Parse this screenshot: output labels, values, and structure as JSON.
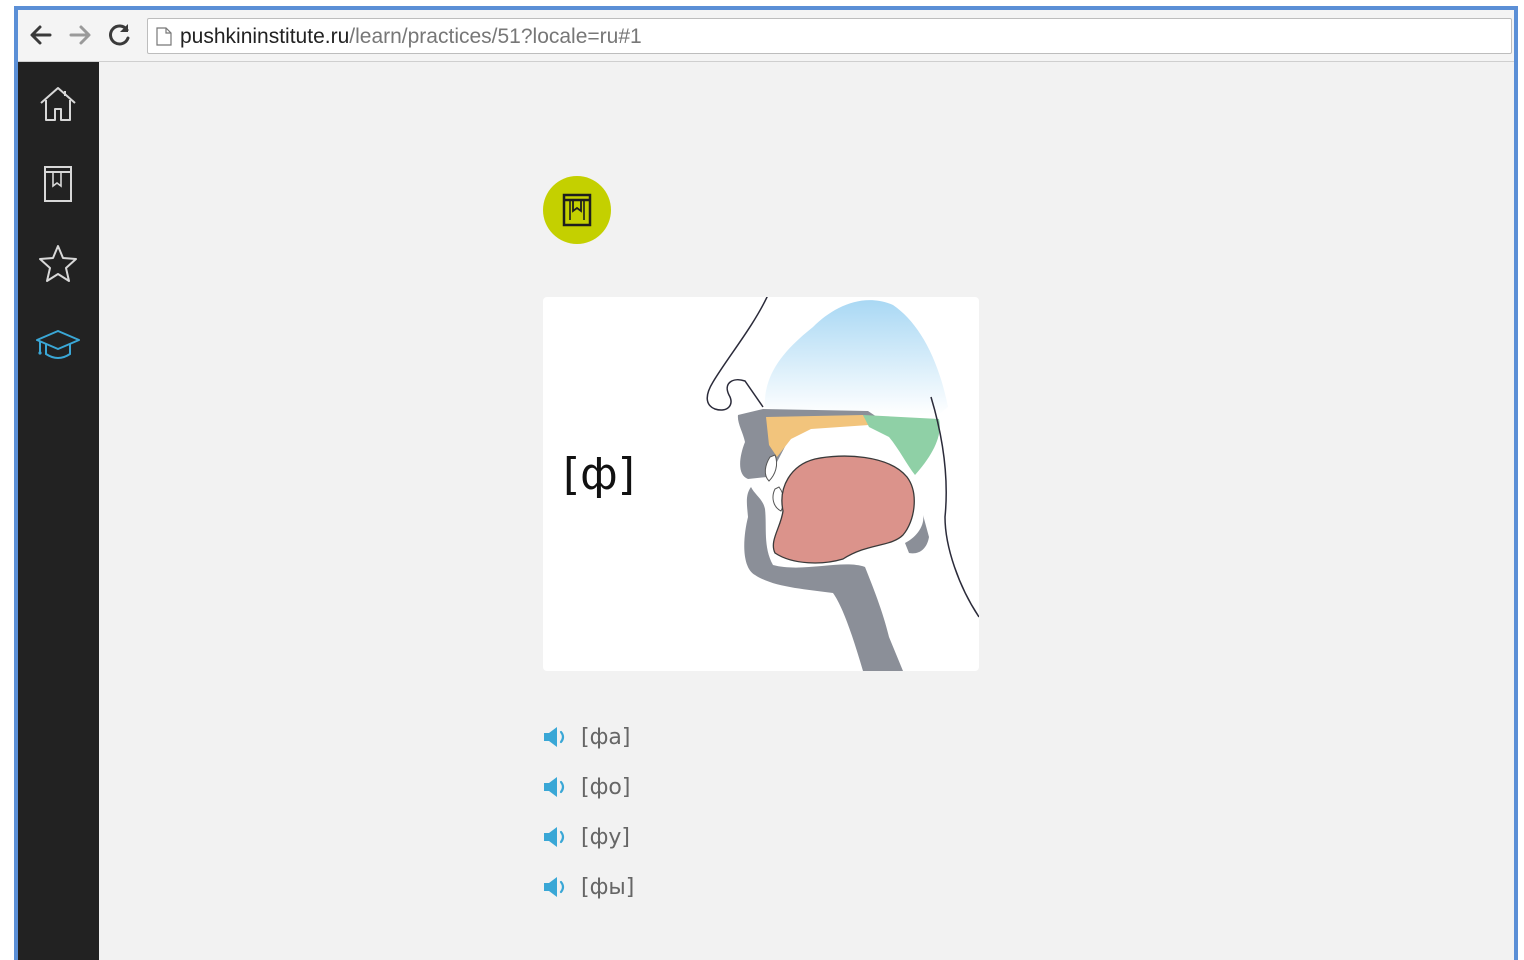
{
  "browser": {
    "url_host": "pushkininstitute.ru",
    "url_path": "/learn/practices/51?locale=ru#1"
  },
  "sidebar": {
    "items": [
      {
        "icon": "home-icon",
        "active": false
      },
      {
        "icon": "book-icon",
        "active": false
      },
      {
        "icon": "star-icon",
        "active": false
      },
      {
        "icon": "graduation-cap-icon",
        "active": true
      }
    ],
    "active_color": "#3aa7d6"
  },
  "lesson": {
    "dictionary_icon": "book-icon",
    "dictionary_color": "#c4d000",
    "sound_symbol": "[ф]",
    "syllables": [
      "[фа]",
      "[фо]",
      "[фу]",
      "[фы]"
    ],
    "speaker_icon": "speaker-icon",
    "speaker_color": "#3aa7d6"
  }
}
